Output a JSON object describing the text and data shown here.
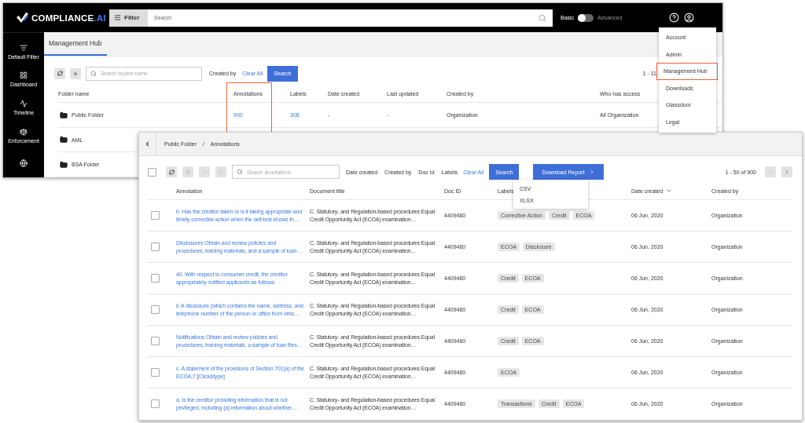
{
  "app": {
    "logo": {
      "name": "COMPLIANCE",
      "suffix": ".AI"
    },
    "filter_button": "Filter",
    "search": {
      "placeholder": "Search"
    },
    "mode_toggle": {
      "left_label": "Basic",
      "right_label": "Advanced",
      "on": false
    }
  },
  "sidebar": {
    "items": [
      {
        "label": "Default Filter",
        "kind": "filter"
      },
      {
        "label": "Dashboard",
        "kind": "dashboard"
      },
      {
        "label": "Timeline",
        "kind": "timeline"
      },
      {
        "label": "Enforcement",
        "kind": "enforcement"
      },
      {
        "kind": "globe"
      }
    ]
  },
  "account_menu": {
    "items": [
      {
        "label": "Account",
        "selected": false
      },
      {
        "label": "Admin",
        "selected": false
      },
      {
        "label": "Management Hub",
        "selected": true
      },
      {
        "label": "Downloads",
        "selected": false
      },
      {
        "label": "Glassdoor",
        "selected": false
      },
      {
        "label": "Legal",
        "selected": false
      }
    ]
  },
  "management_hub": {
    "tab": "Management Hub",
    "search": {
      "placeholder": "Search bucket name"
    },
    "filter": "Created by",
    "clear": "Clear All",
    "search_button": "Search",
    "pagination": "1 - 11",
    "columns": [
      {
        "label": "Folder name",
        "highlighted": false
      },
      {
        "label": "Annotations",
        "highlighted": true
      },
      {
        "label": "Labels",
        "highlighted": false
      },
      {
        "label": "Date created",
        "highlighted": false
      },
      {
        "label": "Last updated",
        "highlighted": false
      },
      {
        "label": "Created by",
        "highlighted": false
      },
      {
        "label": "Who has access",
        "highlighted": false
      }
    ],
    "rows": [
      {
        "name": "Public Folder",
        "cells": [
          "900",
          "308",
          "-",
          "-",
          "Organization",
          "All Organization"
        ]
      },
      {
        "name": "AML"
      },
      {
        "name": "BSA Folder"
      }
    ]
  },
  "annotations_panel": {
    "breadcrumb": [
      "Public Folder",
      "Annotations"
    ],
    "separator": "/",
    "select_all": {
      "checked": false
    },
    "actions": [
      {
        "kind": "refresh",
        "disabled": false
      },
      {
        "kind": "delete",
        "disabled": true
      },
      {
        "kind": "share",
        "disabled": true
      },
      {
        "kind": "tag",
        "disabled": true
      }
    ],
    "search": {
      "placeholder": "Search annotations"
    },
    "filters": [
      "Date created",
      "Created by",
      "Doc Id",
      "Labels"
    ],
    "clear": "Clear All",
    "search_button": "Search",
    "download": {
      "label": "Download Report",
      "expanded": true,
      "options": [
        "CSV",
        "XLSX"
      ]
    },
    "pagination": {
      "text": "1 - 50 of 900",
      "prev_disabled": true,
      "next_disabled": false
    },
    "columns": [
      {
        "label": "Annotation",
        "sorted": false
      },
      {
        "label": "Document title",
        "sorted": false
      },
      {
        "label": "Doc ID",
        "sorted": false
      },
      {
        "label": "Labels",
        "sorted": false
      },
      {
        "label": "Date created",
        "sorted": true
      },
      {
        "label": "Created by",
        "sorted": false
      }
    ],
    "rows": [
      {
        "checked": false,
        "annotation": "b. Has the creditor taken or is it taking appropriate and timely corrective action when the self-test shows th…",
        "document_title": "C. Statutory- and Regulation-based procedures Equal Credit Opportunity Act (ECOA) examination…",
        "doc_id": "4409460",
        "labels": [
          "Corrective Action",
          "Credit",
          "ECOA"
        ],
        "date": "06 Jun, 2020",
        "created_by": "Organization"
      },
      {
        "checked": false,
        "annotation": "Disclosures Obtain and review policies and procedures, training materials, and a sample of loan…",
        "document_title": "C. Statutory- and Regulation-based procedures Equal Credit Opportunity Act (ECOA) examination…",
        "doc_id": "4409460",
        "labels": [
          "ECOA",
          "Disclosure"
        ],
        "date": "06 Jun, 2020",
        "created_by": "Organization"
      },
      {
        "checked": false,
        "annotation": "40. With respect to consumer credit, the creditor appropriately notified applicants as follows:",
        "document_title": "C. Statutory- and Regulation-based procedures Equal Credit Opportunity Act (ECOA) examination…",
        "doc_id": "4409460",
        "labels": [
          "Credit",
          "ECOA"
        ],
        "date": "06 Jun, 2020",
        "created_by": "Organization"
      },
      {
        "checked": false,
        "annotation": "ii. A disclosure (which contains the name, address, and telephone number of the person or office from whic…",
        "document_title": "C. Statutory- and Regulation-based procedures Equal Credit Opportunity Act (ECOA) examination…",
        "doc_id": "4409460",
        "labels": [
          "Credit",
          "ECOA"
        ],
        "date": "06 Jun, 2020",
        "created_by": "Organization"
      },
      {
        "checked": false,
        "annotation": "Notifications Obtain and review policies and procedures, training materials, a sample of loan files…",
        "document_title": "C. Statutory- and Regulation-based procedures Equal Credit Opportunity Act (ECOA) examination…",
        "doc_id": "4409460",
        "labels": [
          "Credit",
          "ECOA"
        ],
        "date": "06 Jun, 2020",
        "created_by": "Organization"
      },
      {
        "checked": false,
        "annotation": "c. A statement of the provisions of Section 701(a) of the ECOA;7 [Click&type]",
        "document_title": "C. Statutory- and Regulation-based procedures Equal Credit Opportunity Act (ECOA) examination…",
        "doc_id": "4409460",
        "labels": [
          "ECOA"
        ],
        "date": "06 Jun, 2020",
        "created_by": "Organization"
      },
      {
        "checked": false,
        "annotation": "a. Is the creditor providing information that is not privileged, including (a) information about whether…",
        "document_title": "C. Statutory- and Regulation-based procedures Equal Credit Opportunity Act (ECOA) examination…",
        "doc_id": "4409460",
        "labels": [
          "Transactions",
          "Credit",
          "ECOA"
        ],
        "date": "06 Jun, 2020",
        "created_by": "Organization"
      }
    ]
  }
}
